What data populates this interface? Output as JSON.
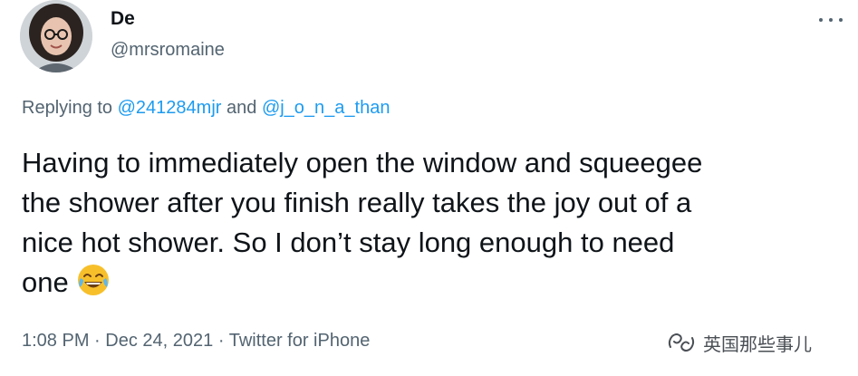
{
  "tweet": {
    "author": {
      "display_name": "De",
      "handle": "@mrsromaine"
    },
    "more_icon": "more-horizontal-icon",
    "reply": {
      "prefix": "Replying to",
      "mention_1": "@241284mjr",
      "connector": "and",
      "mention_2": "@j_o_n_a_than"
    },
    "text": {
      "line_1": "Having to immediately open the window and squeegee",
      "line_2": "the shower after you finish really takes the joy out of a",
      "line_3": "nice hot shower. So I don’t stay long enough to need",
      "line_4": "one"
    },
    "emoji": "face-with-tears-of-joy-icon",
    "meta": {
      "time": "1:08 PM",
      "separator": "·",
      "date": "Dec 24, 2021",
      "source": "Twitter for iPhone"
    }
  },
  "watermark": {
    "text": "英国那些事儿",
    "icon": "wechat-channel-icon"
  },
  "colors": {
    "text_primary": "#0f1419",
    "text_secondary": "#536471",
    "link": "#1d9bf0"
  }
}
